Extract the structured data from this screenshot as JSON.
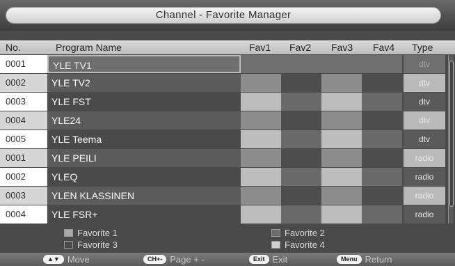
{
  "title": "Channel - Favorite Manager",
  "columns": {
    "no": "No.",
    "program_name": "Program Name",
    "fav1": "Fav1",
    "fav2": "Fav2",
    "fav3": "Fav3",
    "fav4": "Fav4",
    "type": "Type"
  },
  "rows": [
    {
      "no": "0001",
      "name": "YLE  TV1",
      "type": "dtv",
      "selected": true
    },
    {
      "no": "0002",
      "name": "YLE  TV2",
      "type": "dtv"
    },
    {
      "no": "0003",
      "name": "YLE  FST",
      "type": "dtv"
    },
    {
      "no": "0004",
      "name": "YLE24",
      "type": "dtv"
    },
    {
      "no": "0005",
      "name": "YLE  Teema",
      "type": "dtv"
    },
    {
      "no": "0001",
      "name": "YLE  PEILI",
      "type": "radio"
    },
    {
      "no": "0002",
      "name": "YLEQ",
      "type": "radio"
    },
    {
      "no": "0003",
      "name": "YLEN  KLASSINEN",
      "type": "radio"
    },
    {
      "no": "0004",
      "name": "YLE  FSR+",
      "type": "radio"
    }
  ],
  "legend": {
    "fav1": "Favorite  1",
    "fav2": "Favorite  2",
    "fav3": "Favorite  3",
    "fav4": "Favorite  4"
  },
  "footer": {
    "move_key": "▲▼",
    "move": "Move",
    "page_key": "CH+-",
    "page": "Page  +  -",
    "exit_key": "Exit",
    "exit": "Exit",
    "menu_key": "Menu",
    "menu": "Return"
  },
  "colors": {
    "accent_selected": "#6e6e6e",
    "header": "#cfcfcf",
    "background": "#4a4a4a"
  }
}
